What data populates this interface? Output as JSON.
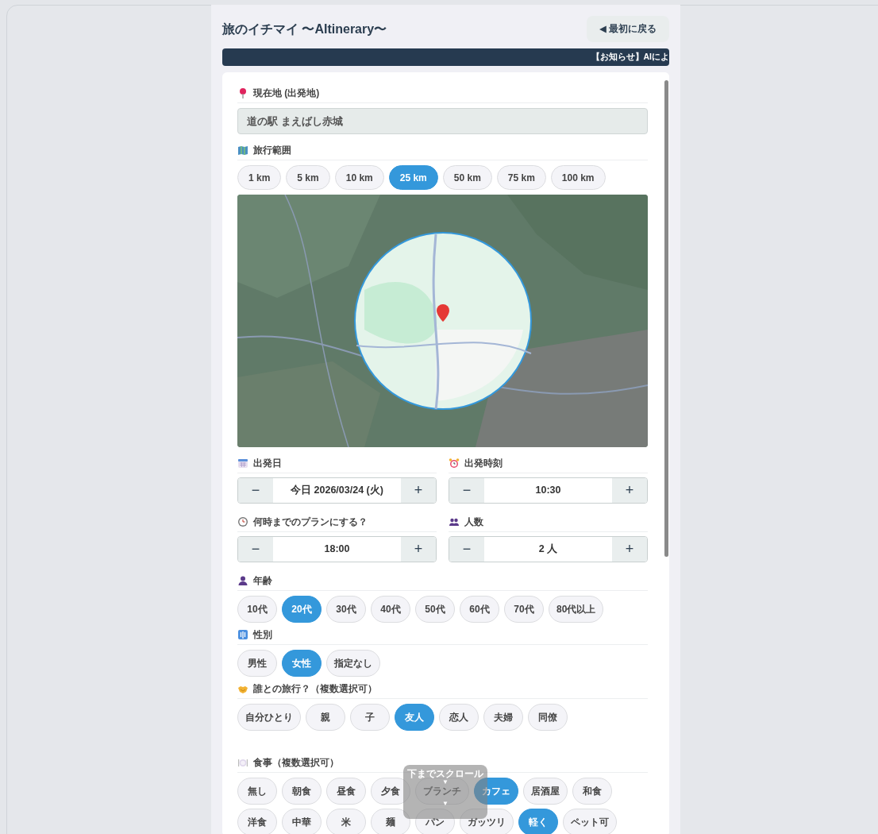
{
  "header": {
    "title": "旅のイチマイ 〜AItinerary〜",
    "back_button": "◀ 最初に戻る"
  },
  "notice": "【お知らせ】AIによ",
  "sections": [
    {
      "kind": "field",
      "label": "現在地 (出発地)",
      "value": "道の駅 まえばし赤城"
    },
    {
      "kind": "chips",
      "label": "旅行範囲",
      "options": [
        {
          "label": "1 km",
          "selected": false
        },
        {
          "label": "5 km",
          "selected": false
        },
        {
          "label": "10 km",
          "selected": false
        },
        {
          "label": "25 km",
          "selected": true
        },
        {
          "label": "50 km",
          "selected": false
        },
        {
          "label": "75 km",
          "selected": false
        },
        {
          "label": "100 km",
          "selected": false
        }
      ]
    },
    {
      "kind": "map"
    },
    {
      "kind": "steppers",
      "items": [
        {
          "label": "出発日",
          "value": "今日 2026/03/24 (火)",
          "decrement": "−",
          "increment": "+"
        },
        {
          "label": "出発時刻",
          "value": "10:30",
          "decrement": "−",
          "increment": "+"
        },
        {
          "label": "何時までのプランにする？",
          "value": "18:00",
          "decrement": "−",
          "increment": "+"
        },
        {
          "label": "人数",
          "value": "2 人",
          "decrement": "−",
          "increment": "+"
        }
      ]
    },
    {
      "kind": "chips",
      "label": "年齢",
      "options": [
        {
          "label": "10代",
          "selected": false
        },
        {
          "label": "20代",
          "selected": true
        },
        {
          "label": "30代",
          "selected": false
        },
        {
          "label": "40代",
          "selected": false
        },
        {
          "label": "50代",
          "selected": false
        },
        {
          "label": "60代",
          "selected": false
        },
        {
          "label": "70代",
          "selected": false
        },
        {
          "label": "80代以上",
          "selected": false
        }
      ]
    },
    {
      "kind": "chips",
      "label": "性別",
      "options": [
        {
          "label": "男性",
          "selected": false
        },
        {
          "label": "女性",
          "selected": true
        },
        {
          "label": "指定なし",
          "selected": false
        }
      ]
    },
    {
      "kind": "chips",
      "label": "誰との旅行？（複数選択可）",
      "options": [
        {
          "label": "自分ひとり",
          "selected": false
        },
        {
          "label": "親",
          "selected": false
        },
        {
          "label": "子",
          "selected": false
        },
        {
          "label": "友人",
          "selected": true
        },
        {
          "label": "恋人",
          "selected": false
        },
        {
          "label": "夫婦",
          "selected": false
        },
        {
          "label": "同僚",
          "selected": false
        }
      ]
    },
    {
      "kind": "chips",
      "label": "食事（複数選択可）",
      "options": [
        {
          "label": "無し",
          "selected": false
        },
        {
          "label": "朝食",
          "selected": false
        },
        {
          "label": "昼食",
          "selected": false
        },
        {
          "label": "夕食",
          "selected": false
        },
        {
          "label": "ブランチ",
          "selected": false
        },
        {
          "label": "カフェ",
          "selected": true
        },
        {
          "label": "居酒屋",
          "selected": false
        },
        {
          "label": "和食",
          "selected": false
        },
        {
          "label": "洋食",
          "selected": false
        },
        {
          "label": "中華",
          "selected": false
        },
        {
          "label": "米",
          "selected": false
        },
        {
          "label": "麺",
          "selected": false
        },
        {
          "label": "パン",
          "selected": false
        },
        {
          "label": "ガッツリ",
          "selected": false
        },
        {
          "label": "軽く",
          "selected": true
        },
        {
          "label": "ペット可",
          "selected": false
        }
      ]
    }
  ],
  "scroll_hint": {
    "label": "下までスクロール",
    "arrows": [
      "▼",
      "▼"
    ]
  }
}
